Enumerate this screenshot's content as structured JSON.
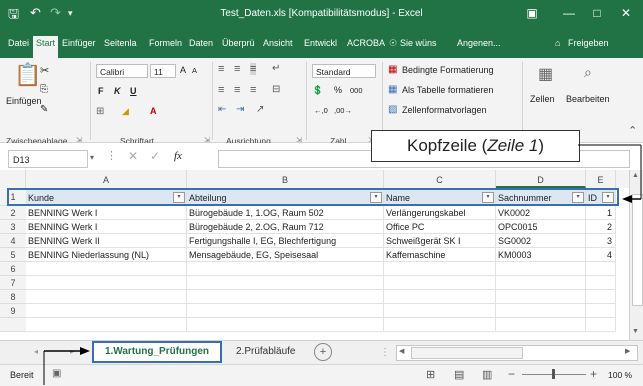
{
  "window": {
    "title": "Test_Daten.xls  [Kompatibilitätsmodus]  -  Excel",
    "controls": [
      "—",
      "□",
      "✕"
    ]
  },
  "ribbon_tabs": [
    "Datei",
    "Start",
    "Einfüger",
    "Seitenla",
    "Formeln",
    "Daten",
    "Überprü",
    "Ansicht",
    "Entwickl",
    "ACROBA",
    "Sie wüns",
    "Angenen...",
    "Freigeben"
  ],
  "ribbon": {
    "paste_label": "Einfügen",
    "font_name": "Calibri",
    "font_size": "11",
    "bold": "F",
    "italic": "K",
    "underline": "U",
    "grow_font": "A",
    "shrink_font": "A",
    "number_format": "Standard",
    "percent": "%",
    "thousands": "000",
    "cond_format": "Bedingte Formatierung",
    "as_table": "Als Tabelle formatieren",
    "cell_styles": "Zellenformatvorlagen",
    "cells_label": "Zellen",
    "editing_label": "Bearbeiten",
    "groups": {
      "clipboard": "Zwischenablage",
      "font": "Schriftart",
      "alignment": "Ausrichtung",
      "number": "Zahl"
    }
  },
  "formula_bar": {
    "name_box": "D13",
    "fx": "fx",
    "value": ""
  },
  "columns": [
    "A",
    "B",
    "C",
    "D",
    "E"
  ],
  "rows": [
    "1",
    "2",
    "3",
    "4",
    "5",
    "6",
    "7",
    "8",
    "9"
  ],
  "table": {
    "headers": [
      "Kunde",
      "Abteilung",
      "Name",
      "Sachnummer",
      "ID"
    ],
    "rows": [
      [
        "BENNING Werk I",
        "Bürogebäude 1, 1.OG, Raum 502",
        "Verlängerungskabel",
        "VK0002",
        "1"
      ],
      [
        "BENNING Werk I",
        "Bürogebäude 2, 2.OG, Raum 712",
        "Office PC",
        "OPC0015",
        "2"
      ],
      [
        "BENNING Werk II",
        "Fertigungshalle I, EG, Blechfertigung",
        "Schweißgerät SK I",
        "SG0002",
        "3"
      ],
      [
        "BENNING Niederlassung (NL)",
        "Mensagebäude, EG, Speisesaal",
        "Kaffemaschine",
        "KM0003",
        "4"
      ]
    ]
  },
  "sheet_tabs": [
    "1.Wartung_Prüfungen",
    "2.Prüfabläufe"
  ],
  "add_sheet": "+",
  "status": {
    "mode": "Bereit",
    "zoom": "100 %"
  },
  "annotation": {
    "callout_prefix": "Kopfzeile (",
    "callout_italic": "Zeile 1",
    "callout_suffix": ")"
  },
  "colors": {
    "excel_green": "#217346",
    "header_fill": "#dde6f3",
    "highlight": "#3b6eb0"
  }
}
